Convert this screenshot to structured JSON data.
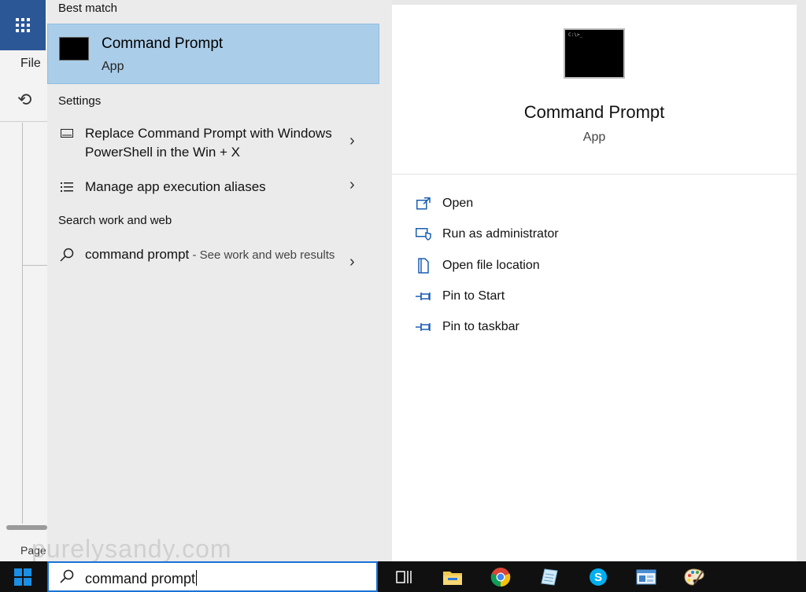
{
  "background_app": {
    "menu_file": "File",
    "status_page": "Page"
  },
  "left_pane": {
    "best_match_header": "Best match",
    "best_match": {
      "title": "Command Prompt",
      "subtitle": "App"
    },
    "settings_header": "Settings",
    "settings": [
      {
        "text_prefix": "Replace ",
        "text_bold": "Command Prompt",
        "text_suffix": " with Windows PowerShell in the Win + X"
      },
      {
        "text": "Manage app execution aliases"
      }
    ],
    "web_header": "Search work and web",
    "web_result": {
      "query": "command prompt",
      "suffix": " - See work and web results"
    }
  },
  "right_pane": {
    "title": "Command Prompt",
    "subtitle": "App",
    "thumb_text": "C:\\>_",
    "actions": [
      {
        "label": "Open",
        "icon": "open-icon"
      },
      {
        "label": "Run as administrator",
        "icon": "shield-icon"
      },
      {
        "label": "Open file location",
        "icon": "file-location-icon"
      },
      {
        "label": "Pin to Start",
        "icon": "pin-icon"
      },
      {
        "label": "Pin to taskbar",
        "icon": "pin-icon"
      }
    ]
  },
  "taskbar": {
    "search_value": "command prompt",
    "apps": [
      "task-view-icon",
      "file-explorer-icon",
      "chrome-icon",
      "notepad-icon",
      "skype-icon",
      "control-panel-icon",
      "paint-icon"
    ]
  },
  "watermark": "purelysandy.com",
  "colors": {
    "accent": "#1a73d4",
    "selection": "#aacde9",
    "action_icon": "#1a5fb4",
    "taskbar": "#101010"
  }
}
